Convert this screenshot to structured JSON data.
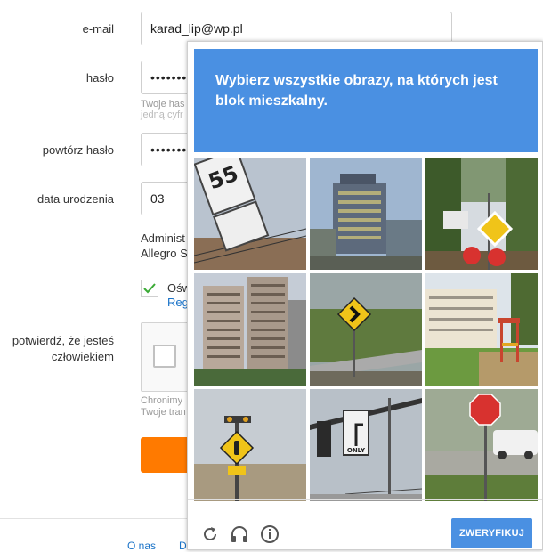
{
  "form": {
    "email_label": "e-mail",
    "email_value": "karad_lip@wp.pl",
    "password_label": "hasło",
    "password_value": "••••••••",
    "password_hint_line1": "Twoje has",
    "password_hint_line2": "jedną cyfr",
    "repeat_password_label": "powtórz hasło",
    "repeat_password_value": "••••••••",
    "birthdate_label": "data urodzenia",
    "birthdate_value": "03",
    "admin_line1": "Administ",
    "admin_line2": "Allegro S",
    "consent_text": "Ośw",
    "consent_link": "Reg",
    "human_label_line1": "potwierdź, że jesteś",
    "human_label_line2": "człowiekiem",
    "protect_line1": "Chronimy",
    "protect_line2": "Twoje tran"
  },
  "footer": {
    "link1": "O nas",
    "link2": "D"
  },
  "captcha": {
    "instruction": "Wybierz wszystkie obrazy, na których jest blok mieszkalny.",
    "verify_label": "ZWERYFIKUJ",
    "tiles": [
      {
        "name": "captcha-tile-speed-sign"
      },
      {
        "name": "captcha-tile-office-building"
      },
      {
        "name": "captcha-tile-road-signs-trees"
      },
      {
        "name": "captcha-tile-apartment-towers"
      },
      {
        "name": "captcha-tile-curve-sign"
      },
      {
        "name": "captcha-tile-apartment-playground"
      },
      {
        "name": "captcha-tile-traffic-light-sign"
      },
      {
        "name": "captcha-tile-only-sign"
      },
      {
        "name": "captcha-tile-stop-sign-street"
      }
    ],
    "icons": [
      "reload-icon",
      "headphones-icon",
      "info-icon"
    ],
    "accent_color": "#4a90e2"
  },
  "colors": {
    "orange": "#ff7a00",
    "link": "#1a73c8"
  }
}
